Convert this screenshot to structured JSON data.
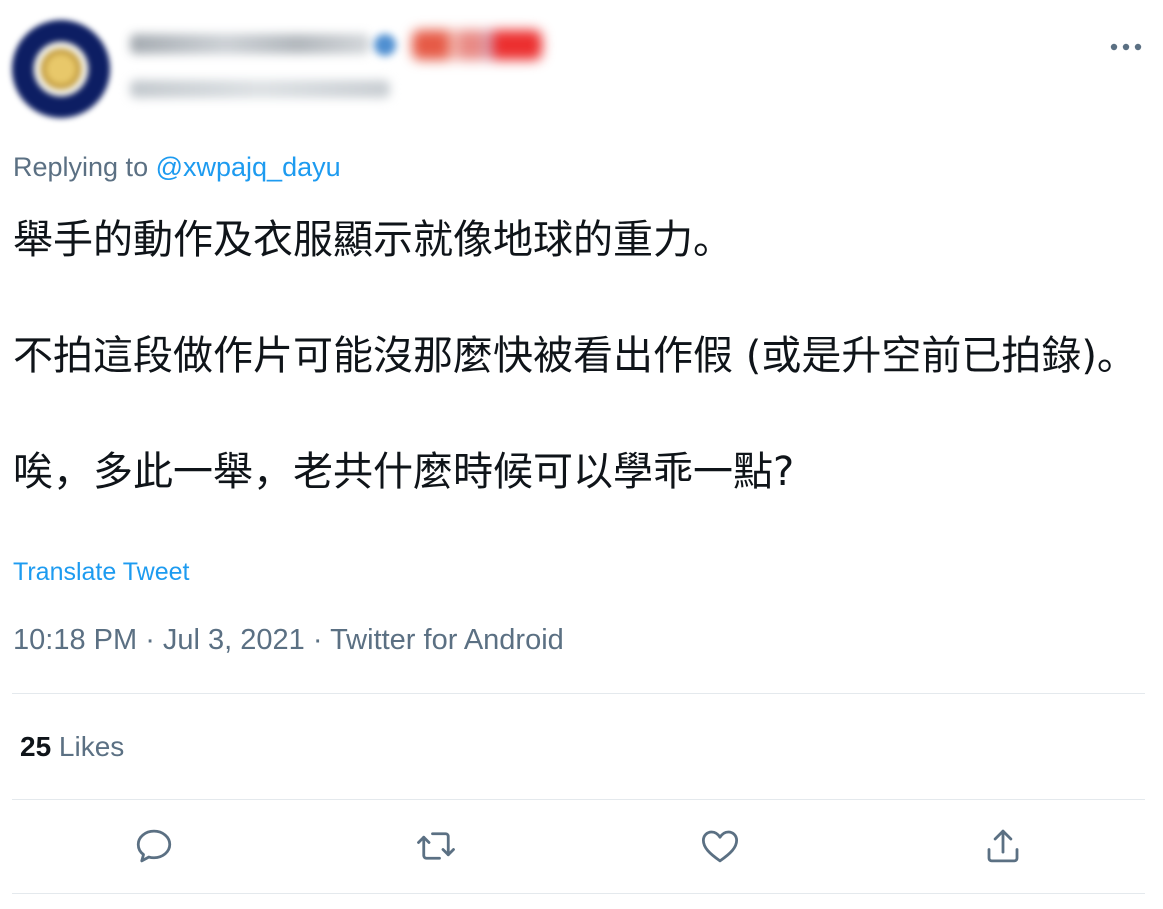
{
  "tweet": {
    "replying_prefix": "Replying to ",
    "replying_to": "@xwpajq_dayu",
    "text_paragraphs": [
      "舉手的動作及衣服顯示就像地球的重力。",
      "不拍這段做作片可能沒那麼快被看出作假 (或是升空前已拍錄)。",
      "唉，多此一舉，老共什麼時候可以學乖一點?"
    ],
    "translate_label": "Translate Tweet",
    "time": "10:18 PM",
    "date": "Jul 3, 2021",
    "source": "Twitter for Android",
    "separator": " · ",
    "likes_count": "25",
    "likes_label": " Likes"
  },
  "icons": {
    "more": "more-horizontal-icon",
    "reply": "reply-icon",
    "retweet": "retweet-icon",
    "like": "heart-icon",
    "share": "share-icon"
  },
  "colors": {
    "text": "#0f1419",
    "secondary": "#5b7083",
    "accent": "#1d9bf0",
    "divider": "#e4e9ed"
  }
}
